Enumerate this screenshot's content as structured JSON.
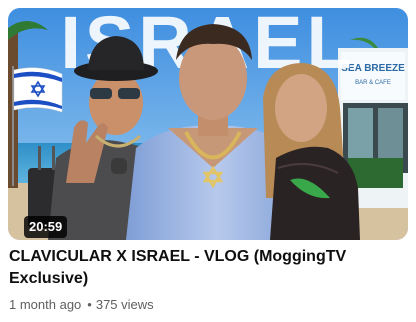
{
  "video": {
    "thumbnail_text": "ISRAEL",
    "sign_text": "SEA BREEZE",
    "sign_subtext": "BAR & CAFE",
    "duration": "20:59",
    "title": "CLAVICULAR X ISRAEL - VLOG (MoggingTV Exclusive)",
    "age": "1 month ago",
    "separator": "•",
    "views": "375 views"
  },
  "icons": {
    "flag": "israel-flag-icon",
    "star": "star-of-david-icon"
  },
  "colors": {
    "sky": "#4f9be0",
    "thumbnail_text": "#ffffff",
    "flag_blue": "#1d4fc4",
    "shirt": "#8fa9d8",
    "title": "#0f0f0f",
    "meta": "#606060"
  }
}
